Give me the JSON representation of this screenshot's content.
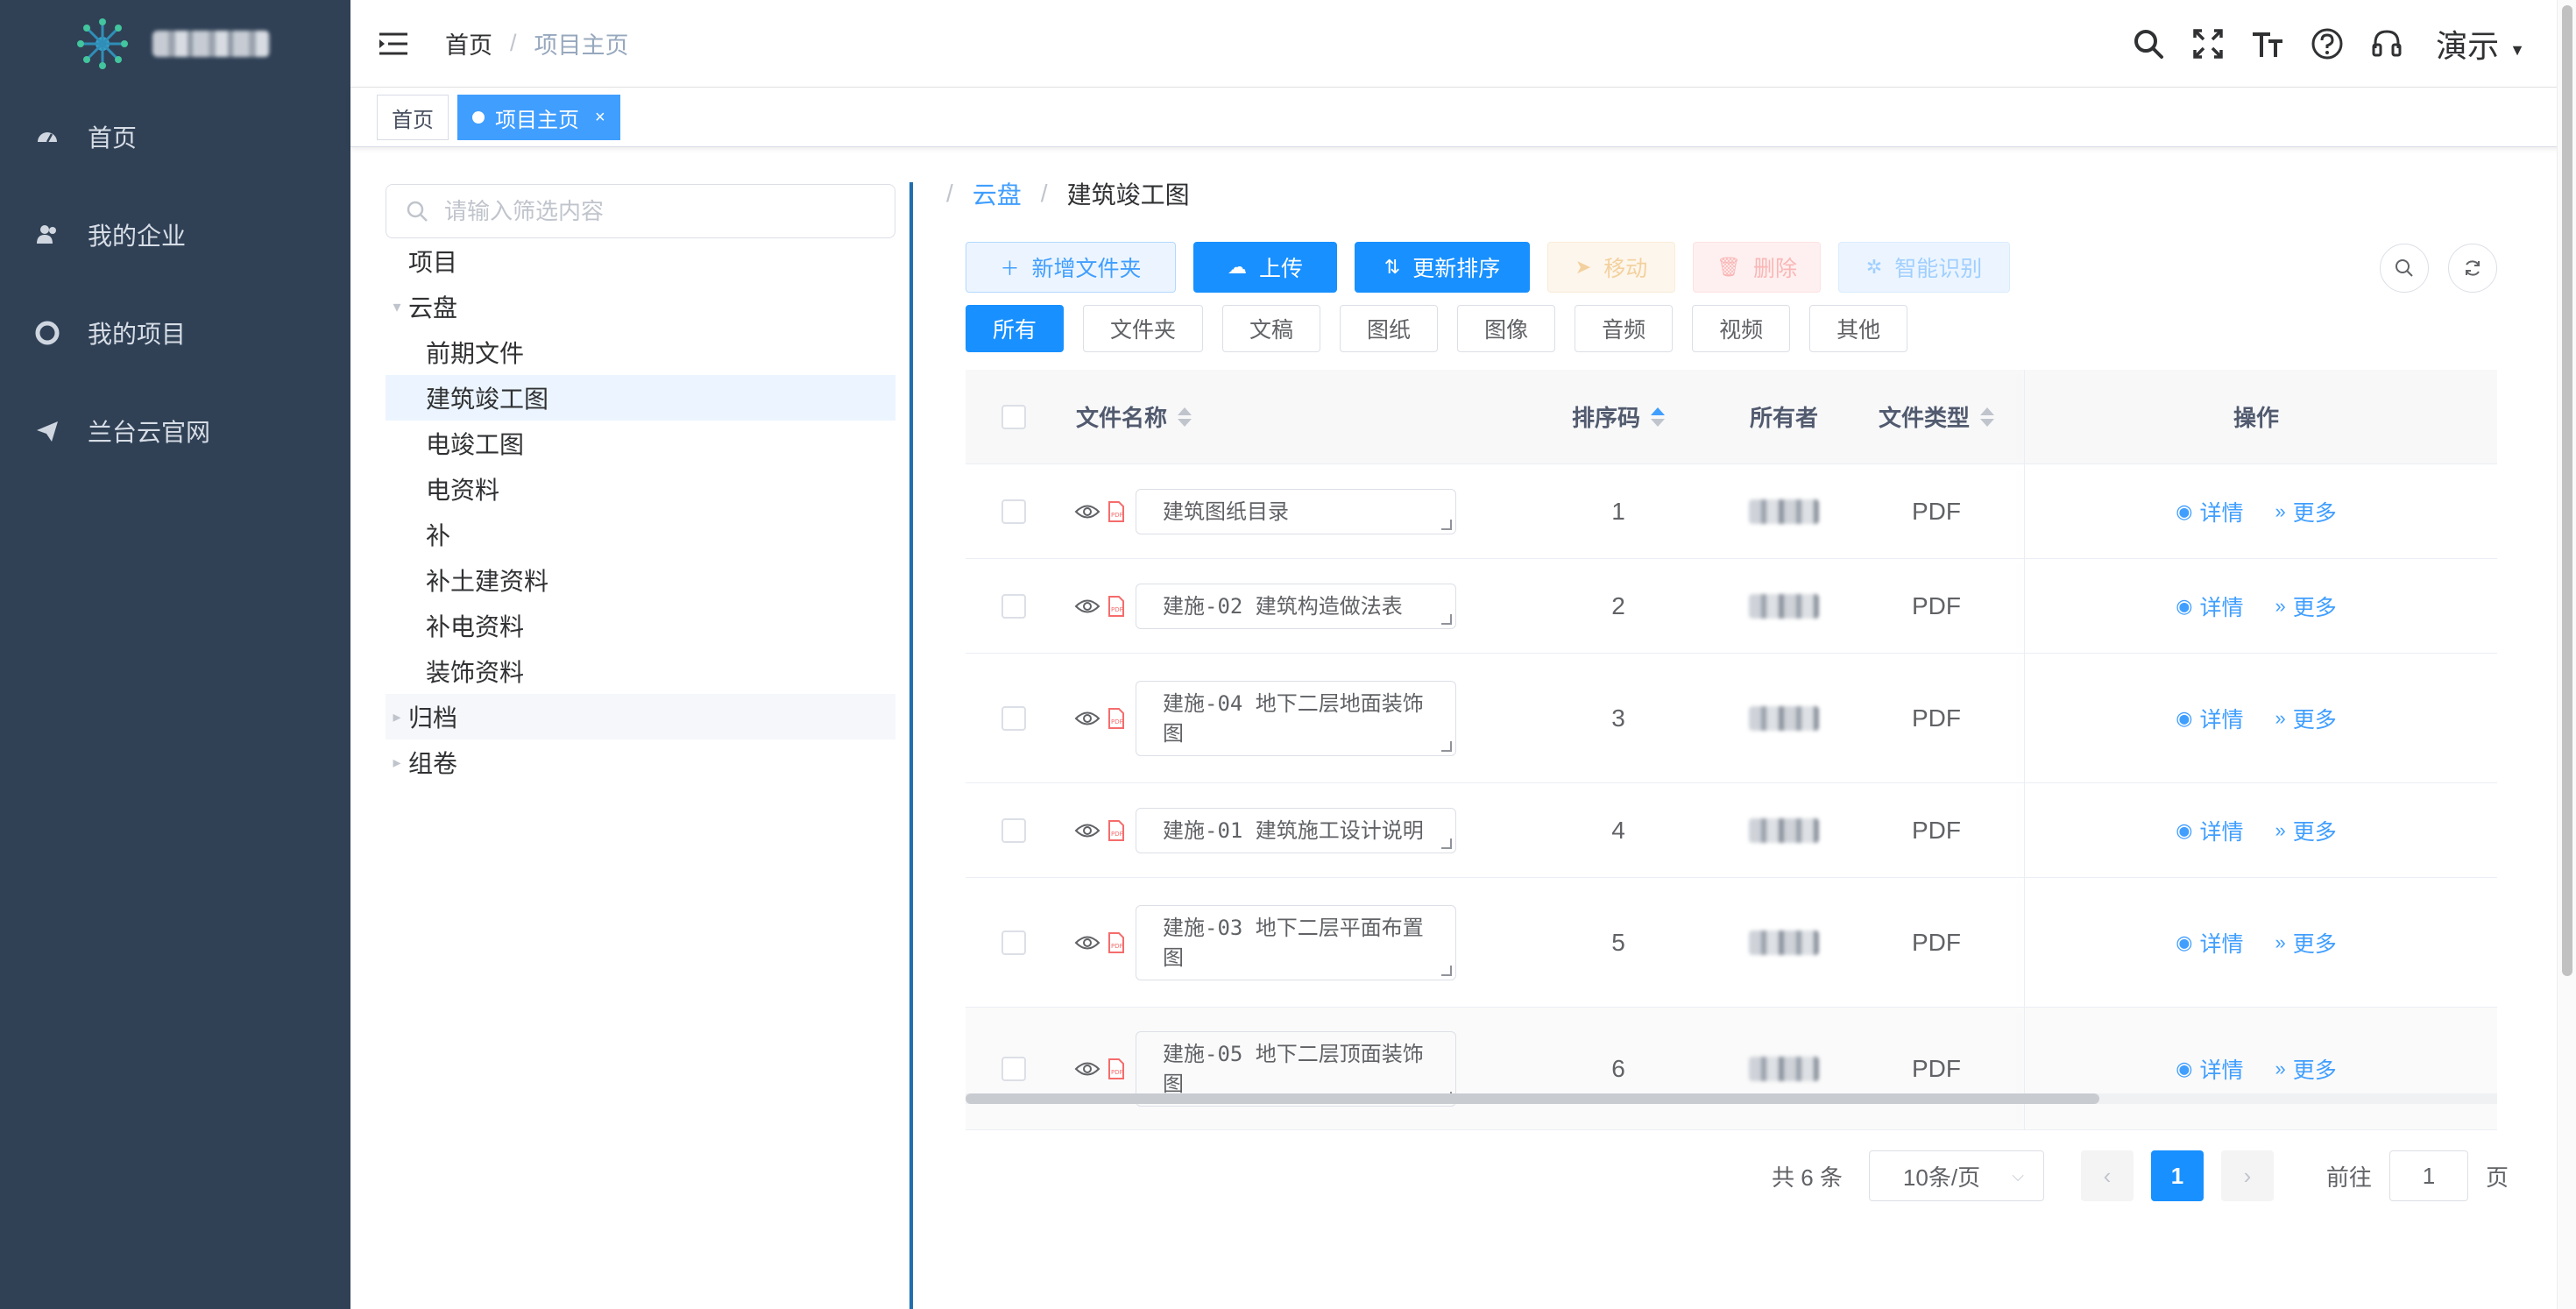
{
  "sidebar": {
    "menu": [
      {
        "label": "首页",
        "icon": "dashboard-icon"
      },
      {
        "label": "我的企业",
        "icon": "user-group-icon"
      },
      {
        "label": "我的项目",
        "icon": "lifebuoy-icon"
      },
      {
        "label": "兰台云官网",
        "icon": "paper-plane-icon"
      }
    ]
  },
  "navbar": {
    "breadcrumb": [
      "首页",
      "项目主页"
    ],
    "user_name": "演示"
  },
  "tags": [
    {
      "label": "首页",
      "active": false
    },
    {
      "label": "项目主页",
      "active": true,
      "close": "×"
    }
  ],
  "tree": {
    "placeholder": "请输入筛选内容",
    "nodes": [
      {
        "label": "项目",
        "level": 0,
        "arrow": ""
      },
      {
        "label": "云盘",
        "level": 0,
        "arrow": "▾"
      },
      {
        "label": "前期文件",
        "level": 1
      },
      {
        "label": "建筑竣工图",
        "level": 1,
        "selected": true
      },
      {
        "label": "电竣工图",
        "level": 1
      },
      {
        "label": "电资料",
        "level": 1
      },
      {
        "label": "补",
        "level": 1
      },
      {
        "label": "补土建资料",
        "level": 1
      },
      {
        "label": "补电资料",
        "level": 1
      },
      {
        "label": "装饰资料",
        "level": 1
      },
      {
        "label": "归档",
        "level": 0,
        "arrow": "▸",
        "hover": true
      },
      {
        "label": "组卷",
        "level": 0,
        "arrow": "▸"
      }
    ]
  },
  "content": {
    "breadcrumb": {
      "link": "云盘",
      "current": "建筑竣工图"
    },
    "toolbar": {
      "new_folder": "新增文件夹",
      "upload": "上传",
      "resort": "更新排序",
      "move": "移动",
      "delete": "删除",
      "recognize": "智能识别"
    },
    "filters": [
      "所有",
      "文件夹",
      "文稿",
      "图纸",
      "图像",
      "音频",
      "视频",
      "其他"
    ],
    "table": {
      "headers": {
        "name": "文件名称",
        "order": "排序码",
        "owner": "所有者",
        "type": "文件类型",
        "ops": "操作"
      },
      "rows": [
        {
          "name": "建筑图纸目录",
          "order": "1",
          "type": "PDF"
        },
        {
          "name": "建施-02 建筑构造做法表",
          "order": "2",
          "type": "PDF"
        },
        {
          "name": "建施-04 地下二层地面装饰图",
          "order": "3",
          "type": "PDF"
        },
        {
          "name": "建施-01 建筑施工设计说明",
          "order": "4",
          "type": "PDF"
        },
        {
          "name": "建施-03 地下二层平面布置图",
          "order": "5",
          "type": "PDF"
        },
        {
          "name": "建施-05 地下二层顶面装饰图",
          "order": "6",
          "type": "PDF"
        }
      ],
      "op_detail": "详情",
      "op_more": "更多"
    },
    "pagination": {
      "total": "共 6 条",
      "page_size": "10条/页",
      "current": "1",
      "goto_prefix": "前往",
      "goto_value": "1",
      "goto_suffix": "页"
    }
  },
  "colors": {
    "sidebar": "#304156",
    "primary": "#1890ff",
    "link": "#409eff"
  }
}
